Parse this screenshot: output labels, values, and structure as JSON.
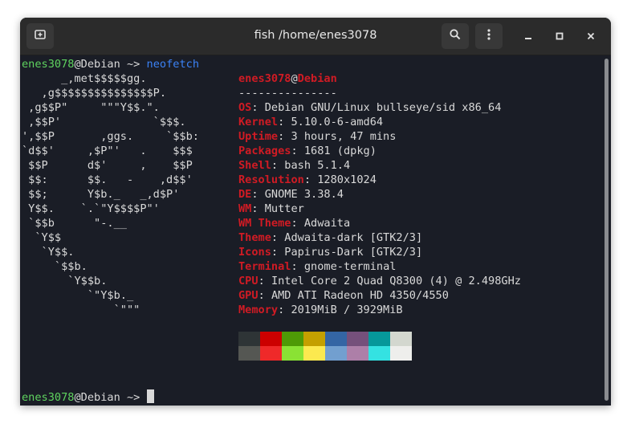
{
  "window": {
    "title": "fish /home/enes3078"
  },
  "terminal": {
    "prompt1": {
      "user": "enes3078",
      "at": "@",
      "host": "Debian",
      "arrow": " ~> ",
      "command": "neofetch"
    },
    "logo_lines": [
      "      _,met$$$$$gg.",
      "   ,g$$$$$$$$$$$$$$$P.",
      " ,g$$P\"     \"\"\"Y$$.\".",
      " ,$$P'              `$$$.",
      "',$$P       ,ggs.     `$$b:",
      "`d$$'     ,$P\"'   .    $$$",
      " $$P      d$'     ,    $$P",
      " $$:      $$.   -    ,d$$'",
      " $$;      Y$b._   _,d$P'",
      " Y$$.    `.`\"Y$$$$P\"'",
      " `$$b      \"-.__",
      "  `Y$$",
      "   `Y$$.",
      "     `$$b.",
      "       `Y$$b.",
      "          `\"Y$b._",
      "              `\"\"\""
    ],
    "header": {
      "user": "enes3078",
      "at": "@",
      "host": "Debian",
      "separator": "---------------"
    },
    "info": [
      {
        "key": "OS",
        "value": "Debian GNU/Linux bullseye/sid x86_64"
      },
      {
        "key": "Kernel",
        "value": "5.10.0-6-amd64"
      },
      {
        "key": "Uptime",
        "value": "3 hours, 47 mins"
      },
      {
        "key": "Packages",
        "value": "1681 (dpkg)"
      },
      {
        "key": "Shell",
        "value": "bash 5.1.4"
      },
      {
        "key": "Resolution",
        "value": "1280x1024"
      },
      {
        "key": "DE",
        "value": "GNOME 3.38.4"
      },
      {
        "key": "WM",
        "value": "Mutter"
      },
      {
        "key": "WM Theme",
        "value": "Adwaita"
      },
      {
        "key": "Theme",
        "value": "Adwaita-dark [GTK2/3]"
      },
      {
        "key": "Icons",
        "value": "Papirus-Dark [GTK2/3]"
      },
      {
        "key": "Terminal",
        "value": "gnome-terminal"
      },
      {
        "key": "CPU",
        "value": "Intel Core 2 Quad Q8300 (4) @ 2.498GHz"
      },
      {
        "key": "GPU",
        "value": "AMD ATI Radeon HD 4350/4550"
      },
      {
        "key": "Memory",
        "value": "2019MiB / 3929MiB"
      }
    ],
    "palette_top": [
      "#2e3436",
      "#cc0000",
      "#4e9a06",
      "#c4a000",
      "#3465a4",
      "#75507b",
      "#06989a",
      "#d3d7cf"
    ],
    "palette_bottom": [
      "#555753",
      "#ef2929",
      "#8ae234",
      "#fce94f",
      "#729fcf",
      "#ad7fa8",
      "#34e2e2",
      "#eeeeec"
    ],
    "prompt2": {
      "user": "enes3078",
      "at": "@",
      "host": "Debian",
      "arrow": " ~> "
    }
  },
  "icons": {
    "new_tab": "new-tab-icon",
    "search": "search-icon",
    "menu": "menu-icon",
    "minimize": "minimize-icon",
    "maximize": "maximize-icon",
    "close": "close-icon"
  }
}
